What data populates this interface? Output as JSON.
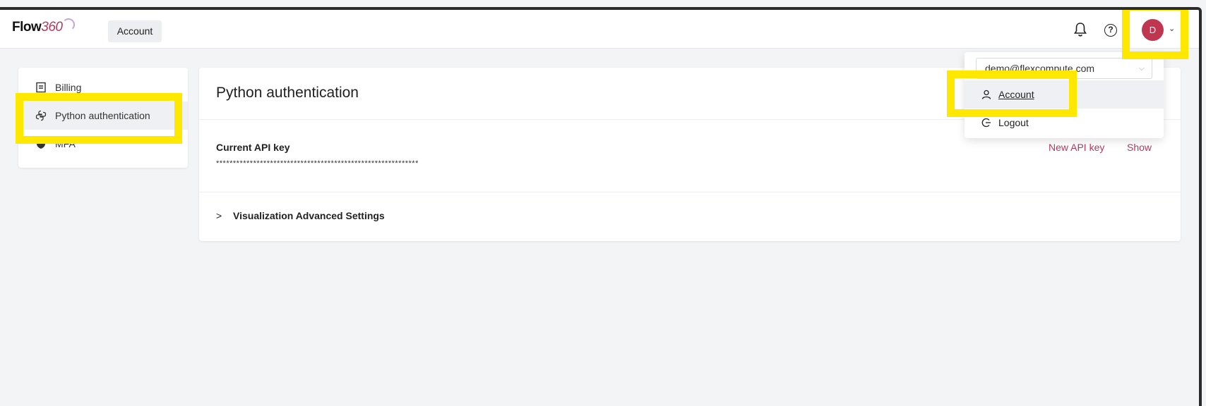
{
  "header": {
    "logo_text": "Flow",
    "logo_num": "360",
    "tab_label": "Account",
    "avatar_initial": "D"
  },
  "sidebar": {
    "items": [
      {
        "label": "Billing",
        "icon": "billing-icon"
      },
      {
        "label": "Python authentication",
        "icon": "python-icon",
        "active": true
      },
      {
        "label": "MFA",
        "icon": "shield-icon"
      }
    ]
  },
  "main": {
    "title": "Python authentication",
    "api_label": "Current API key",
    "api_value": "************************************************************",
    "new_key_label": "New API key",
    "show_label": "Show",
    "viz_label": "Visualization Advanced Settings"
  },
  "dropdown": {
    "email": "demo@flexcompute.com",
    "account_label": "Account",
    "logout_label": "Logout"
  },
  "colors": {
    "accent": "#b23a5a",
    "avatar": "#c0354f",
    "highlight": "#ffe800"
  }
}
